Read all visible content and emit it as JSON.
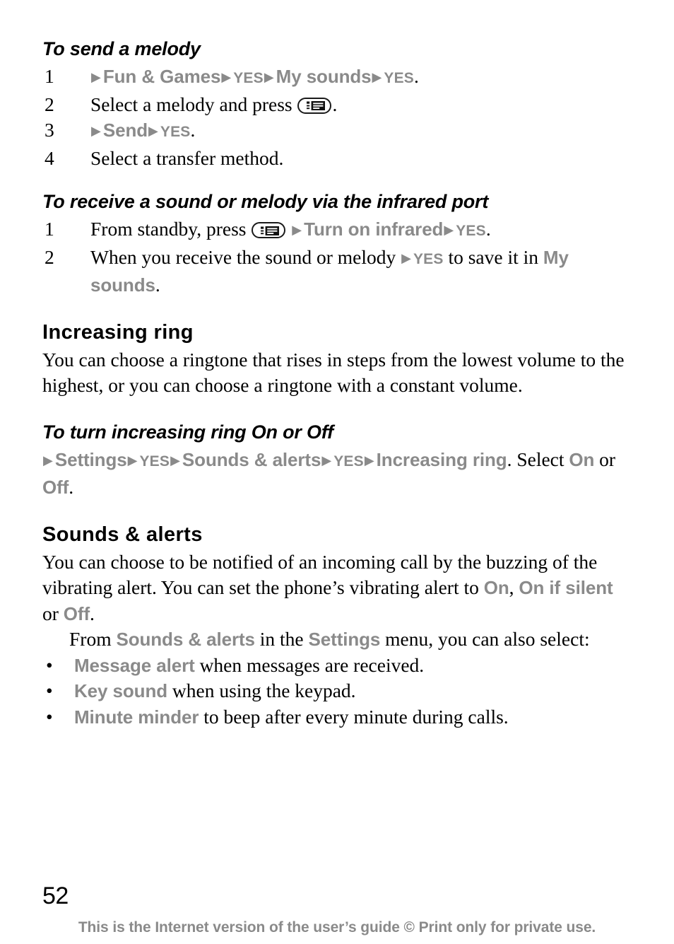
{
  "document": {
    "page_number": "52",
    "footer_note": "This is the Internet version of the user’s guide © Print only for private use.",
    "arrow_glyph": "▶",
    "bullet_glyph": "•",
    "ui_text_color": "#8a8a8a",
    "body_text_color": "#000000"
  },
  "sections": {
    "send_melody": {
      "heading": "To send a melody",
      "steps": [
        {
          "number": "1",
          "parts": [
            {
              "type": "arrow"
            },
            {
              "type": "ui",
              "text": "Fun & Games"
            },
            {
              "type": "arrow"
            },
            {
              "type": "ui-key",
              "text": "YES"
            },
            {
              "type": "arrow"
            },
            {
              "type": "ui",
              "text": "My sounds"
            },
            {
              "type": "arrow"
            },
            {
              "type": "ui-key",
              "text": "YES"
            },
            {
              "type": "text",
              "text": "."
            }
          ]
        },
        {
          "number": "2",
          "parts": [
            {
              "type": "text",
              "text": "Select a melody and press "
            },
            {
              "type": "keyicon"
            },
            {
              "type": "text",
              "text": "."
            }
          ]
        },
        {
          "number": "3",
          "parts": [
            {
              "type": "arrow"
            },
            {
              "type": "ui",
              "text": "Send"
            },
            {
              "type": "arrow"
            },
            {
              "type": "ui-key",
              "text": "YES"
            },
            {
              "type": "text",
              "text": "."
            }
          ]
        },
        {
          "number": "4",
          "parts": [
            {
              "type": "text",
              "text": "Select a transfer method."
            }
          ]
        }
      ]
    },
    "receive_infrared": {
      "heading": "To receive a sound or melody via the infrared port",
      "steps": [
        {
          "number": "1",
          "parts": [
            {
              "type": "text",
              "text": "From standby, press "
            },
            {
              "type": "keyicon"
            },
            {
              "type": "text",
              "text": " "
            },
            {
              "type": "arrow"
            },
            {
              "type": "ui",
              "text": "Turn on infrared"
            },
            {
              "type": "arrow"
            },
            {
              "type": "ui-key",
              "text": "YES"
            },
            {
              "type": "text",
              "text": "."
            }
          ]
        },
        {
          "number": "2",
          "parts": [
            {
              "type": "text",
              "text": "When you receive the sound or melody "
            },
            {
              "type": "arrow"
            },
            {
              "type": "ui-key",
              "text": "YES"
            },
            {
              "type": "text",
              "text": " to save it in "
            },
            {
              "type": "ui",
              "text": "My sounds"
            },
            {
              "type": "text",
              "text": "."
            }
          ]
        }
      ]
    },
    "increasing_ring": {
      "heading": "Increasing ring",
      "body": "You can choose a ringtone that rises in steps from the lowest volume to the highest, or you can choose a ringtone with a constant volume."
    },
    "turn_increasing_ring": {
      "heading": "To turn increasing ring On or Off",
      "parts": [
        {
          "type": "arrow"
        },
        {
          "type": "ui",
          "text": "Settings"
        },
        {
          "type": "arrow"
        },
        {
          "type": "ui-key",
          "text": "YES"
        },
        {
          "type": "arrow"
        },
        {
          "type": "ui",
          "text": "Sounds & alerts"
        },
        {
          "type": "arrow"
        },
        {
          "type": "ui-key",
          "text": "YES"
        },
        {
          "type": "arrow"
        },
        {
          "type": "ui",
          "text": "Increasing ring"
        },
        {
          "type": "text",
          "text": ". Select "
        },
        {
          "type": "ui",
          "text": "On"
        },
        {
          "type": "text",
          "text": " or "
        },
        {
          "type": "ui",
          "text": "Off"
        },
        {
          "type": "text",
          "text": "."
        }
      ]
    },
    "sounds_alerts": {
      "heading": "Sounds & alerts",
      "paragraph1_parts": [
        {
          "type": "text",
          "text": "You can choose to be notified of an incoming call by the buzzing of the vibrating alert. You can set the phone’s vibrating alert to "
        },
        {
          "type": "ui",
          "text": "On"
        },
        {
          "type": "text",
          "text": ", "
        },
        {
          "type": "ui",
          "text": "On if silent"
        },
        {
          "type": "text",
          "text": " or "
        },
        {
          "type": "ui",
          "text": "Off"
        },
        {
          "type": "text",
          "text": "."
        }
      ],
      "paragraph2_parts": [
        {
          "type": "text",
          "text": "From "
        },
        {
          "type": "ui",
          "text": "Sounds & alerts"
        },
        {
          "type": "text",
          "text": " in the "
        },
        {
          "type": "ui",
          "text": "Settings"
        },
        {
          "type": "text",
          "text": " menu, you can also select:"
        }
      ],
      "bullets": [
        [
          {
            "type": "ui",
            "text": "Message alert"
          },
          {
            "type": "text",
            "text": " when messages are received."
          }
        ],
        [
          {
            "type": "ui",
            "text": "Key sound"
          },
          {
            "type": "text",
            "text": " when using the keypad."
          }
        ],
        [
          {
            "type": "ui",
            "text": "Minute minder"
          },
          {
            "type": "text",
            "text": " to beep after every minute during calls."
          }
        ]
      ]
    }
  }
}
